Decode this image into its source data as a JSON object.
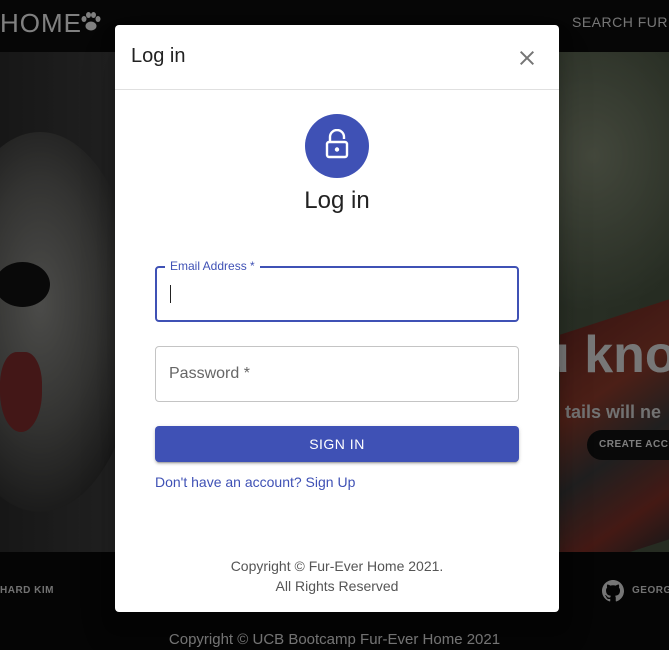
{
  "nav": {
    "brand": "HOME",
    "search_label": "SEARCH FUR"
  },
  "hero": {
    "headline_partial": "u kno",
    "sub_partial": "tails will ne",
    "button_partial": "CREATE ACCO"
  },
  "footer": {
    "left_name": "HARD KIM",
    "right_name": "GEORG",
    "copyright": "Copyright © UCB Bootcamp Fur-Ever Home 2021"
  },
  "dialog": {
    "title": "Log in",
    "heading": "Log in",
    "email_label": "Email Address *",
    "email_value": "",
    "password_label": "Password *",
    "signin_label": "SIGN IN",
    "signup_link": "Don't have an account? Sign Up",
    "copyright_line1": "Copyright © Fur-Ever Home 2021.",
    "copyright_line2": "All Rights Reserved"
  },
  "colors": {
    "primary": "#3f51b5",
    "topbar": "#0b0b0b"
  },
  "icons": {
    "brand": "paw-icon",
    "close": "close-icon",
    "avatar": "lock-open-icon",
    "footer": "github-icon"
  }
}
